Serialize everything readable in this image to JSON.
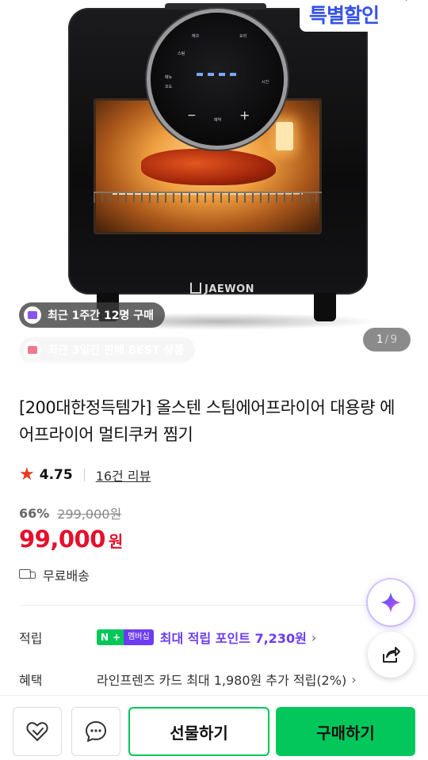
{
  "hero": {
    "sale_banner": "특별할인",
    "brand_logo": "JAEWON",
    "dial_labels": [
      "에코",
      "스팀",
      "요리",
      "메뉴",
      "조도",
      "시간",
      "예약",
      "−",
      "+"
    ],
    "recent_purchase_pill": "최근 1주간 12명 구매",
    "best_seller_pill": "최근 3일간 판매 BEST 상품",
    "pager": {
      "current": "1",
      "separator": "/",
      "total": "9"
    }
  },
  "product": {
    "title": "[200대한정득템가] 올스텐 스팀에어프라이어 대용량 에어프라이어 멀티쿠커 찜기",
    "rating": "4.75",
    "review_count_label": "16건 리뷰",
    "discount_rate": "66%",
    "original_price": "299,000원",
    "sale_price": "99,000",
    "currency": "원",
    "shipping": "무료배송"
  },
  "details": {
    "points_label": "적립",
    "npay_badge": "N",
    "npay_plus": "+",
    "membership_badge": "멤버십",
    "points_text": "최대 적립 포인트 7,230원",
    "benefit_label": "혜택",
    "benefit_text": "라인프렌즈 카드 최대 1,980원 추가 적립(2%)"
  },
  "bottom_bar": {
    "gift_label": "선물하기",
    "buy_label": "구매하기"
  },
  "colors": {
    "accent_green": "#03c75a",
    "price_red": "#e4102c",
    "points_purple": "#6c3cf2",
    "star_red": "#e8391c"
  },
  "icons": [
    "bag-icon",
    "gift-icon",
    "star-icon",
    "truck-icon",
    "chevron-right-icon",
    "ai-sparkle-icon",
    "share-icon",
    "heart-icon",
    "chat-icon"
  ]
}
